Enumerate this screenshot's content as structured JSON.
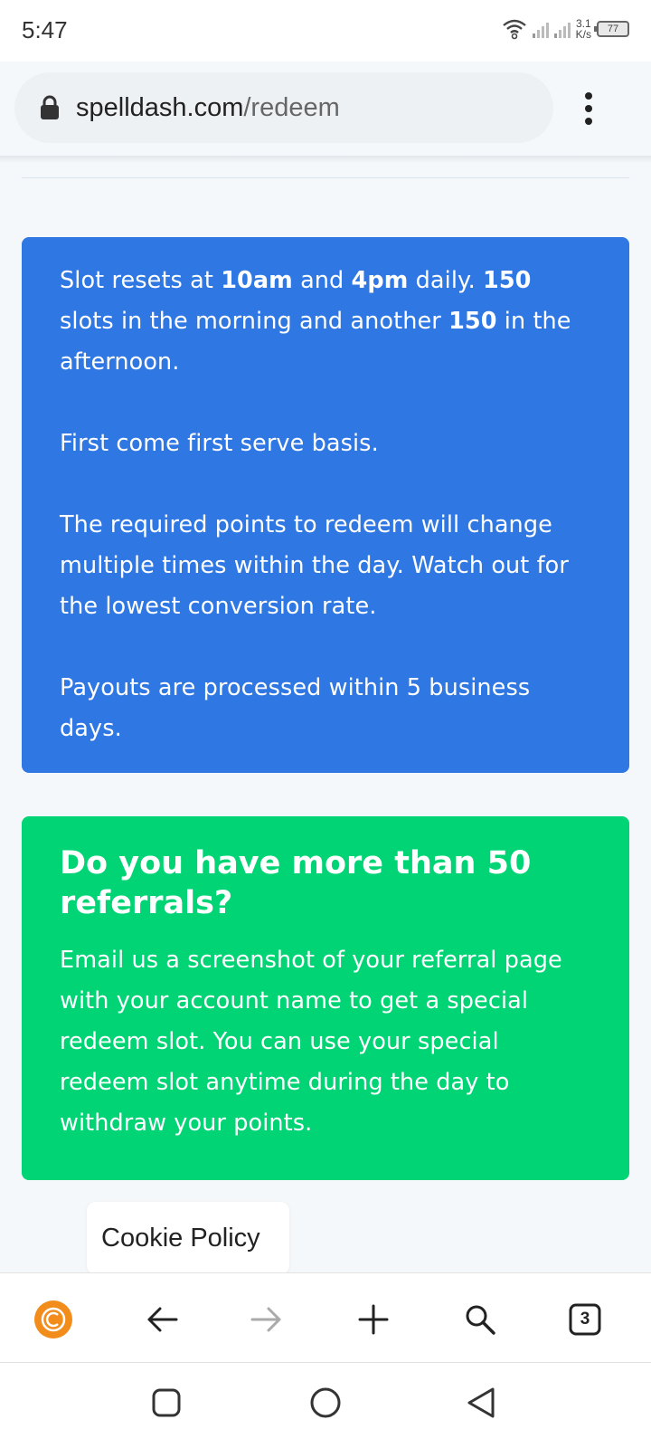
{
  "status_bar": {
    "time": "5:47",
    "network_speed_value": "3.1",
    "network_speed_unit": "K/s",
    "battery_level": "77",
    "icons": [
      "wifi-icon",
      "signal-icon",
      "signal-icon",
      "battery-icon"
    ]
  },
  "browser": {
    "url_host": "spelldash.com",
    "url_path": "/redeem",
    "lock_icon": "lock-icon",
    "menu_icon": "more-vert-icon"
  },
  "info_card": {
    "color": "#2f77e3",
    "p1_a": "Slot resets at ",
    "p1_b": "10am",
    "p1_c": " and ",
    "p1_d": "4pm",
    "p1_e": " daily. ",
    "p1_f": "150",
    "p1_g": " slots in the morning and another ",
    "p1_h": "150",
    "p1_i": " in the afternoon.",
    "p2": "First come first serve basis.",
    "p3": "The required points to redeem will change multiple times within the day. Watch out for the lowest conversion rate.",
    "p4": "Payouts are processed within 5 business days."
  },
  "referral_card": {
    "color": "#00d474",
    "title": "Do you have more than 50 referrals?",
    "body": "Email us a screenshot of your referral page with your account name to get a special redeem slot. You can use your special redeem slot anytime during the day to withdraw your points."
  },
  "cookie_policy": {
    "label": "Cookie Policy"
  },
  "browser_nav": {
    "tab_count": "3",
    "icons": [
      "browser-logo-icon",
      "back-arrow-icon",
      "forward-arrow-icon",
      "new-tab-icon",
      "search-icon",
      "tabs-icon"
    ],
    "accent_color": "#f28c1b"
  },
  "system_nav": {
    "icons": [
      "recents-icon",
      "home-icon",
      "back-icon"
    ]
  }
}
